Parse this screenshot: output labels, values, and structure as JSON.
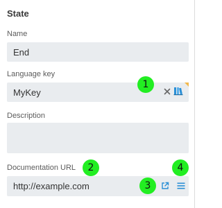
{
  "panel": {
    "title": "State"
  },
  "fields": {
    "name": {
      "label": "Name",
      "value": "End"
    },
    "language_key": {
      "label": "Language key",
      "value": "MyKey"
    },
    "description": {
      "label": "Description",
      "value": ""
    },
    "documentation_url": {
      "label": "Documentation URL",
      "value": "http://example.com"
    }
  },
  "callouts": [
    "1",
    "2",
    "3",
    "4"
  ],
  "icons": {
    "clear": "close-icon",
    "language_lookup": "book-icon",
    "open_link": "external-link-icon",
    "menu": "hamburger-menu-icon"
  },
  "colors": {
    "field_bg": "#e9ecef",
    "accent": "#2a8fd6",
    "callout": "#22ee22",
    "corner_marker": "#f2b84b"
  }
}
